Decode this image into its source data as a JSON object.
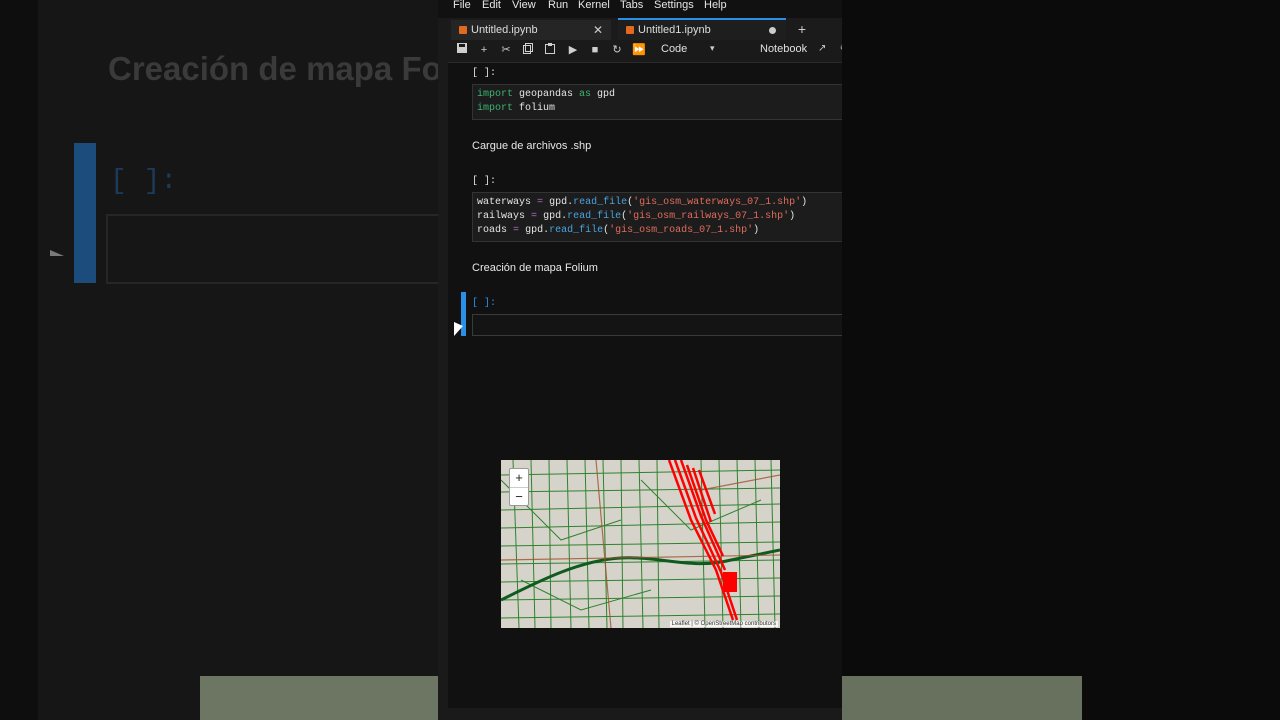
{
  "menu": [
    "File",
    "Edit",
    "View",
    "Run",
    "Kernel",
    "Tabs",
    "Settings",
    "Help"
  ],
  "tabs": [
    {
      "label": "Untitled.ipynb",
      "close": "✕",
      "active": false
    },
    {
      "label": "Untitled1.ipynb",
      "close": "●",
      "active": true
    }
  ],
  "toolbar": {
    "cell_type": "Code",
    "kernel": "Notebook"
  },
  "cells": {
    "c1_prompt": "[ ]:",
    "c1_line1_kw": "import",
    "c1_line1_rest": " geopandas ",
    "c1_line1_kw2": "as",
    "c1_line1_end": " gpd",
    "c1_line2_kw": "import",
    "c1_line2_rest": " folium",
    "md1": "Cargue de archivos .shp",
    "c2_prompt": "[ ]:",
    "c2_l1_var": "waterways",
    "c2_l1_mod": "gpd.",
    "c2_l1_fn": "read_file",
    "c2_l1_str": "'gis_osm_waterways_07_1.shp'",
    "c2_l2_var": "railways",
    "c2_l2_mod": "gpd.",
    "c2_l2_fn": "read_file",
    "c2_l2_str": "'gis_osm_railways_07_1.shp'",
    "c2_l3_var": "roads",
    "c2_l3_mod": "gpd.",
    "c2_l3_fn": "read_file",
    "c2_l3_str": "'gis_osm_roads_07_1.shp'",
    "md2": "Creación de mapa Folium",
    "c3_prompt": "[ ]:"
  },
  "background": {
    "title": "Creación de mapa Foli",
    "prompt": "[ ]:"
  },
  "map": {
    "zoom_in": "+",
    "zoom_out": "−",
    "attribution": "Leaflet | © OpenStreetMap contributors",
    "road_color": "#1e7a1e",
    "rail_color": "#ff0000",
    "water_color": "#2a6b3a"
  }
}
